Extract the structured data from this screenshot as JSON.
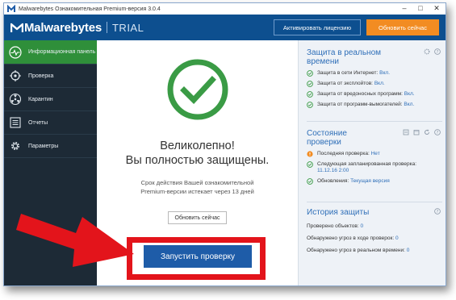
{
  "window": {
    "title": "Malwarebytes Ознакомительная Premium-версия 3.0.4",
    "controls": [
      "–",
      "□",
      "✕"
    ]
  },
  "header": {
    "brand": "Malwarebytes",
    "edition": "TRIAL",
    "activate_label": "Активировать лицензию",
    "upgrade_label": "Обновить сейчас",
    "colors": {
      "bar": "#0d4f8f",
      "upgrade": "#f28c22"
    }
  },
  "sidebar": {
    "items": [
      {
        "label": "Информационная панель",
        "icon": "pulse-icon",
        "active": true
      },
      {
        "label": "Проверка",
        "icon": "scan-target-icon",
        "active": false
      },
      {
        "label": "Карантин",
        "icon": "radiation-icon",
        "active": false
      },
      {
        "label": "Отчеты",
        "icon": "report-list-icon",
        "active": false
      },
      {
        "label": "Параметры",
        "icon": "gear-icon",
        "active": false
      }
    ],
    "active_color": "#2f8f3a"
  },
  "main": {
    "headline_line1": "Великолепно!",
    "headline_line2": "Вы полностью защищены.",
    "sub_line1": "Срок действия Вашей ознакомительной",
    "sub_line2": "Premium-версии истекает через 13 дней",
    "renew_label": "Обновить сейчас",
    "scan_label": "Запустить проверку"
  },
  "realtime": {
    "title_line1": "Защита в реальном",
    "title_line2": "времени",
    "items": [
      {
        "label": "Защита в сети Интернет:",
        "value": "Вкл."
      },
      {
        "label": "Защита от эксплойтов:",
        "value": "Вкл."
      },
      {
        "label": "Защита от вредоносных программ:",
        "value": "Вкл."
      },
      {
        "label": "Защита от программ-вымогателей:",
        "value": "Вкл."
      }
    ]
  },
  "status": {
    "title_line1": "Состояние",
    "title_line2": "проверки",
    "last_scan_label": "Последняя проверка:",
    "last_scan_value": "Нет",
    "next_scan_label": "Следующая запланированная проверка:",
    "next_scan_value": "11.12.16 2:00",
    "updates_label": "Обновления:",
    "updates_value": "Текущая версия"
  },
  "history": {
    "title": "История защиты",
    "rows": [
      {
        "label": "Проверено объектов:",
        "value": "0"
      },
      {
        "label": "Обнаружено угроз в ходе проверок:",
        "value": "0"
      },
      {
        "label": "Обнаружено угроз в реальном времени:",
        "value": "0"
      }
    ]
  },
  "annotation": {
    "color": "#e3141b"
  }
}
